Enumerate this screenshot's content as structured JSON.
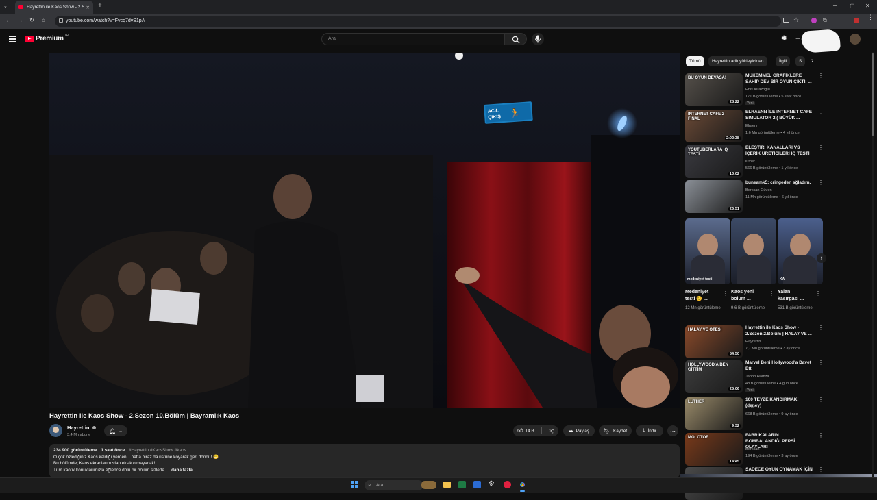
{
  "browser": {
    "tab_title": "Hayrettin ile Kaos Show - 2.Sezon",
    "url": "youtube.com/watch?v=Fvcq7dvS1pA"
  },
  "header": {
    "logo_text": "Premium",
    "logo_sup": "TR",
    "search_placeholder": "Ara"
  },
  "video": {
    "exit_sign": "ACİL\nÇIKIŞ",
    "title": "Hayrettin ile Kaos Show - 2.Sezon 10.Bölüm | Bayramlık Kaos",
    "channel": "Hayrettin",
    "subscribers": "3,4 Mn abone",
    "likes": "14 B",
    "share_label": "Paylaş",
    "save_label": "Kaydet",
    "download_label": "İndir"
  },
  "description": {
    "views": "234.900 görüntüleme",
    "age": "1 saat önce",
    "tags": "#Hayrettin #KaosShow #kaos",
    "line1": "O çok özlediğiniz Kaos kaldığı yerden... hatta biraz da üstüne koyarak geri döndü! 😁",
    "line2": "Bu bölümde; Kaos ekranlarınızdan eksik olmayacak!",
    "line3": "Tüm kaotik konuklarımızla eğlence dolu bir bölüm sizlerle",
    "more": "...daha fazla"
  },
  "chips": [
    "Tümü",
    "Hayrettin adlı yükleyiciden",
    "İlgili",
    "S"
  ],
  "recs": [
    {
      "title": "MÜKEMMEL GRAFİKLERE SAHİP DEV BİR OYUN ÇIKTI: ...",
      "channel": "Enis Kirazoglu",
      "meta": "171 B görüntüleme • 5 saat önce",
      "badge": "Yeni",
      "duration": "28:22",
      "thumb_text": "BU OYUN DEVASA!",
      "color": "#55504a"
    },
    {
      "title": "ELRAENN İLE INTERNET CAFE SIMULATOR 2 ( BÜYÜK ...",
      "channel": "Elraenn",
      "meta": "1,6 Mn görüntüleme • 4 yıl önce",
      "badge": "",
      "duration": "2:02:38",
      "thumb_text": "INTERNET CAFE 2 FINAL",
      "color": "#6b4a36"
    },
    {
      "title": "ELEŞTİRİ KANALLARI VS İÇERİK ÜRETİCİLERİ IQ TESTİ",
      "channel": "luther",
      "meta": "566 B görüntüleme • 1 yıl önce",
      "badge": "",
      "duration": "13:02",
      "thumb_text": "YOUTUBERLARA IQ TESTİ",
      "color": "#3a3a40"
    },
    {
      "title": "buneamk5: cringeden ağladım.",
      "channel": "Berkcan Güven",
      "meta": "11 Mn görüntüleme • 6 yıl önce",
      "badge": "",
      "duration": "26:51",
      "thumb_text": "",
      "color": "#8a8f96"
    }
  ],
  "shorts": [
    {
      "title": "Medeniyet testi 😊 ...",
      "meta": "12 Mn görüntüleme",
      "color": "#5b6b8d",
      "caption": "medeniyet testi"
    },
    {
      "title": "Kaos yeni bölüm ...",
      "meta": "9,6 B görüntüleme",
      "color": "#3c4a66",
      "caption": ""
    },
    {
      "title": "Yalan kasırgası ...",
      "meta": "531 B görüntüleme",
      "color": "#4b5f8c",
      "caption": "KA"
    }
  ],
  "recs2": [
    {
      "title": "Hayrettin ile Kaos Show - 2.Sezon 2.Bölüm | HALAY VE ...",
      "channel": "Hayrettin",
      "meta": "7,7 Mn görüntüleme • 3 ay önce",
      "badge": "",
      "duration": "54:50",
      "thumb_text": "HALAY VE ÖTESİ",
      "color": "#8a4a2a"
    },
    {
      "title": "Marvel Beni Hollywood'a Davet Etti",
      "channel": "Japon Hamza",
      "meta": "48 B görüntüleme • 4 gün önce",
      "badge": "Yeni",
      "duration": "25:06",
      "thumb_text": "HOLLYWOOD'A BEN GİTTİM",
      "color": "#3d3d3d"
    },
    {
      "title": "100 TEYZE KANDIRMAK! (deney)",
      "channel": "luther",
      "meta": "668 B görüntüleme • 9 ay önce",
      "badge": "",
      "duration": "9:32",
      "thumb_text": "LUTHER",
      "color": "#9a8b6a"
    },
    {
      "title": "FABRİKALARIN BOMBALANDIĞI PEPSİ OLAYLARI",
      "channel": "Berkcan",
      "meta": "194 B görüntüleme • 3 ay önce",
      "badge": "",
      "duration": "14:45",
      "thumb_text": "MOLOTOF",
      "color": "#7a3a1a"
    },
    {
      "title": "SADECE OYUN OYNAMAK İÇİN",
      "channel": "",
      "meta": "",
      "badge": "",
      "duration": "",
      "thumb_text": "",
      "color": "#4a4a4a"
    }
  ],
  "taskbar": {
    "search_text": "Ara"
  }
}
